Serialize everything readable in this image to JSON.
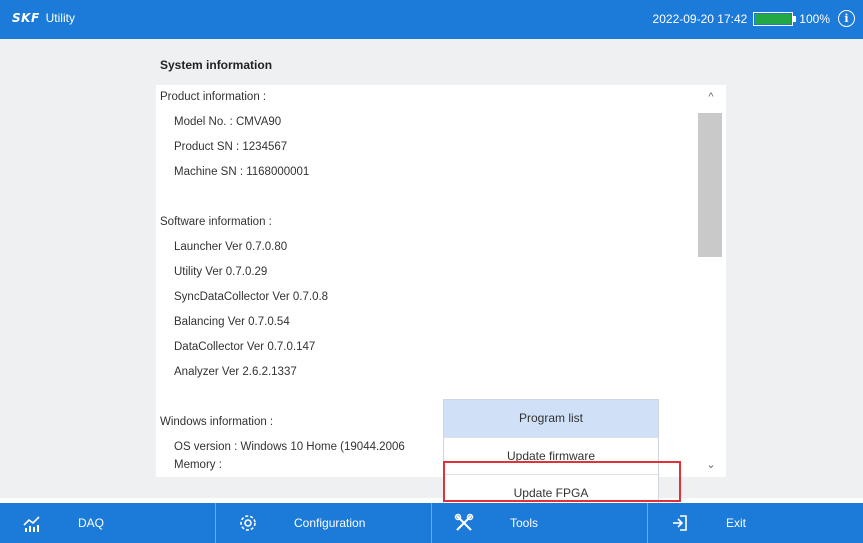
{
  "header": {
    "brand": "SKF",
    "app_name": "Utility",
    "datetime": "2022-09-20 17:42",
    "battery_percent": "100%",
    "battery_level": 1.0,
    "battery_color": "#22a946",
    "info_icon": "info-icon",
    "info_glyph": "i",
    "accent_color": "#1c7ad8"
  },
  "panel": {
    "title": "System information",
    "lines": [
      "Product information :",
      "Model No. : CMVA90",
      "Product SN : 1234567",
      "Machine SN : 1168000001",
      "Software information :",
      "Launcher  Ver 0.7.0.80",
      "Utility  Ver 0.7.0.29",
      "SyncDataCollector  Ver 0.7.0.8",
      "Balancing  Ver 0.7.0.54",
      "DataCollector  Ver 0.7.0.147",
      "Analyzer  Ver 2.6.2.1337",
      "Windows information :",
      "OS version : Windows 10 Home  (19044.2006",
      "Memory :"
    ],
    "scroll_up_glyph": "^",
    "scroll_down_glyph": "⌄"
  },
  "tools_menu": {
    "items": [
      "Program list",
      "Update firmware",
      "Update FPGA"
    ],
    "selected": "Program list",
    "highlighted": "Update FPGA",
    "highlight_color": "#e0323a"
  },
  "bottom_nav": {
    "tabs": [
      {
        "label": "DAQ",
        "icon": "daq-chart-icon"
      },
      {
        "label": "Configuration",
        "icon": "gear-icon"
      },
      {
        "label": "Tools",
        "icon": "tools-icon"
      },
      {
        "label": "Exit",
        "icon": "exit-icon"
      }
    ]
  }
}
